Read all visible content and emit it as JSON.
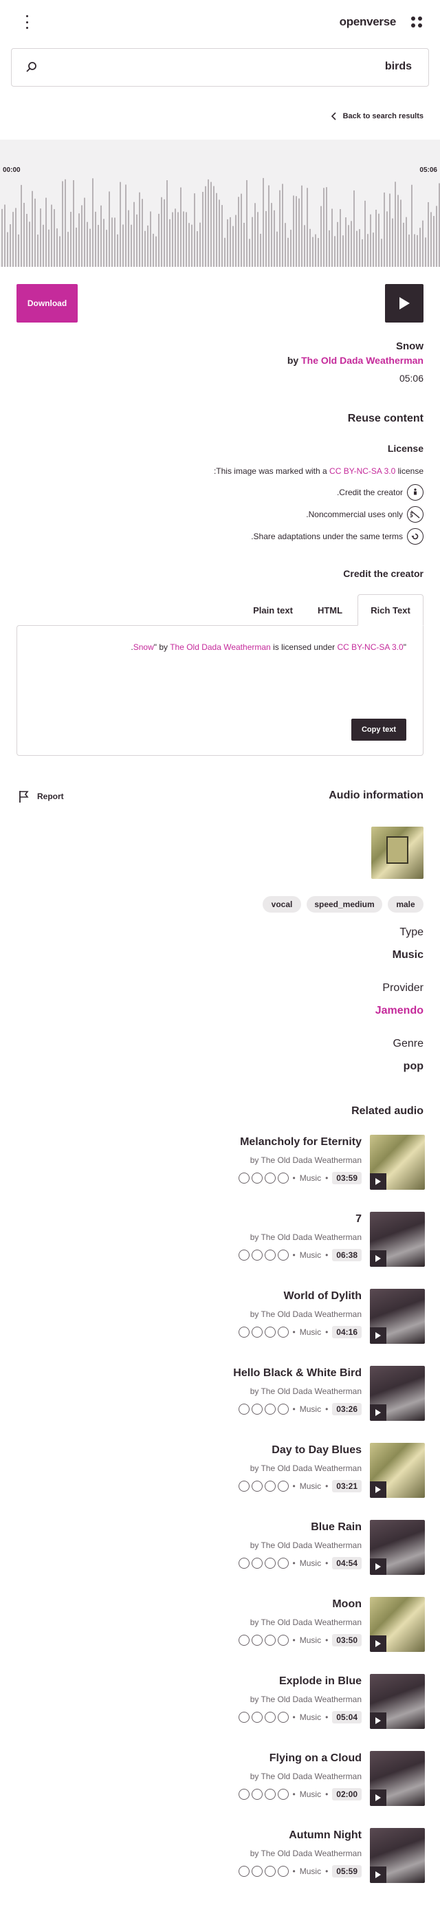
{
  "header": {
    "logo": "openverse"
  },
  "search": {
    "value": "birds"
  },
  "back_link": "Back to search results",
  "player": {
    "start_time": "00:00",
    "end_time": "05:06"
  },
  "actions": {
    "download_label": "Download"
  },
  "track": {
    "title": "Snow",
    "by_prefix": "by",
    "artist": "The Old Dada Weatherman",
    "duration": "05:06"
  },
  "reuse": {
    "heading": "Reuse content",
    "license_heading": "License",
    "license_line_prefix": "This image was marked with a",
    "license_name": "CC BY-NC-SA 3.0",
    "license_line_suffix": "license:",
    "conditions": [
      {
        "label": "Credit the creator.",
        "icon": "by-icon"
      },
      {
        "label": "Noncommercial uses only.",
        "icon": "nc-icon"
      },
      {
        "label": "Share adaptations under the same terms.",
        "icon": "sa-icon"
      }
    ],
    "credit_heading": "Credit the creator",
    "tabs": [
      "Plain text",
      "HTML",
      "Rich Text"
    ],
    "active_tab": "Rich Text",
    "credit": {
      "quote_open": "\"",
      "title": "Snow",
      "by": "\" by",
      "artist": "The Old Dada Weatherman",
      "licensed": "is licensed under",
      "license": "CC BY-NC-SA 3.0",
      "end": "."
    },
    "copy_label": "Copy text"
  },
  "report_label": "Report",
  "audio_info": {
    "heading": "Audio information",
    "tags": [
      "vocal",
      "speed_medium",
      "male"
    ],
    "type_label": "Type",
    "type_value": "Music",
    "provider_label": "Provider",
    "provider_value": "Jamendo",
    "genre_label": "Genre",
    "genre_value": "pop"
  },
  "related": {
    "heading": "Related audio",
    "items": [
      {
        "title": "Melancholy for Eternity",
        "by": "by The Old Dada Weatherman",
        "category": "Music",
        "duration": "03:59",
        "art": "a"
      },
      {
        "title": "7",
        "by": "by The Old Dada Weatherman",
        "category": "Music",
        "duration": "06:38",
        "art": "b"
      },
      {
        "title": "World of Dylith",
        "by": "by The Old Dada Weatherman",
        "category": "Music",
        "duration": "04:16",
        "art": "b"
      },
      {
        "title": "Hello Black & White Bird",
        "by": "by The Old Dada Weatherman",
        "category": "Music",
        "duration": "03:26",
        "art": "b"
      },
      {
        "title": "Day to Day Blues",
        "by": "by The Old Dada Weatherman",
        "category": "Music",
        "duration": "03:21",
        "art": "a"
      },
      {
        "title": "Blue Rain",
        "by": "by The Old Dada Weatherman",
        "category": "Music",
        "duration": "04:54",
        "art": "b"
      },
      {
        "title": "Moon",
        "by": "by The Old Dada Weatherman",
        "category": "Music",
        "duration": "03:50",
        "art": "a"
      },
      {
        "title": "Explode in Blue",
        "by": "by The Old Dada Weatherman",
        "category": "Music",
        "duration": "05:04",
        "art": "b"
      },
      {
        "title": "Flying on a Cloud",
        "by": "by The Old Dada Weatherman",
        "category": "Music",
        "duration": "02:00",
        "art": "b"
      },
      {
        "title": "Autumn Night",
        "by": "by The Old Dada Weatherman",
        "category": "Music",
        "duration": "05:59",
        "art": "b"
      }
    ]
  }
}
